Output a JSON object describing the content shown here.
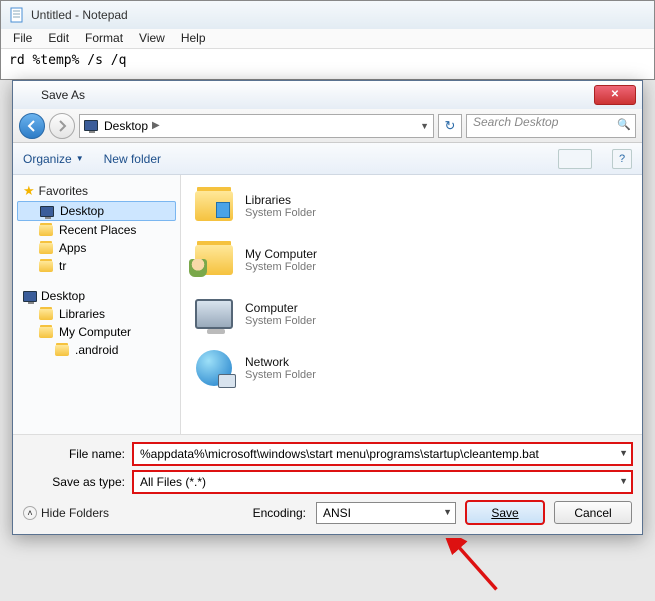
{
  "notepad": {
    "title": "Untitled - Notepad",
    "menu": [
      "File",
      "Edit",
      "Format",
      "View",
      "Help"
    ],
    "content": "rd %temp% /s /q"
  },
  "dialog": {
    "title": "Save As",
    "path_location": "Desktop",
    "path_arrow": "▶",
    "search_placeholder": "Search Desktop",
    "toolbar": {
      "organize": "Organize",
      "new_folder": "New folder"
    },
    "nav": {
      "favorites": "Favorites",
      "fav_items": [
        "Desktop",
        "Recent Places",
        "Apps",
        "tr"
      ],
      "desktop": "Desktop",
      "tree_items": [
        "Libraries",
        "My Computer",
        ".android"
      ]
    },
    "files": [
      {
        "name": "Libraries",
        "sub": "System Folder"
      },
      {
        "name": "My Computer",
        "sub": "System Folder"
      },
      {
        "name": "Computer",
        "sub": "System Folder"
      },
      {
        "name": "Network",
        "sub": "System Folder"
      }
    ],
    "form": {
      "filename_label": "File name:",
      "filename_value": "%appdata%\\microsoft\\windows\\start menu\\programs\\startup\\cleantemp.bat",
      "type_label": "Save as type:",
      "type_value": "All Files (*.*)",
      "hide_folders": "Hide Folders",
      "encoding_label": "Encoding:",
      "encoding_value": "ANSI",
      "save": "Save",
      "cancel": "Cancel"
    }
  }
}
